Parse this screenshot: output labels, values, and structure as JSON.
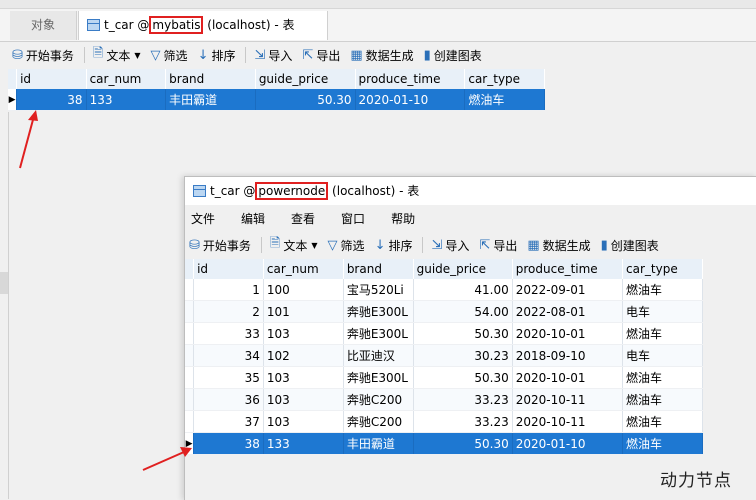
{
  "colors": {
    "selection": "#1e78d2",
    "highlight_box": "#e02020",
    "arrow": "#e02020"
  },
  "top_tabs": {
    "objects_label": "对象",
    "main_prefix": "t_car @",
    "main_db": "mybatis",
    "main_suffix": " (localhost) - 表"
  },
  "toolbar": {
    "begin_tx": "开始事务",
    "text": "文本",
    "filter": "筛选",
    "sort": "排序",
    "import": "导入",
    "export": "导出",
    "gen_data": "数据生成",
    "create_chart": "创建图表"
  },
  "columns": [
    "id",
    "car_num",
    "brand",
    "guide_price",
    "produce_time",
    "car_type"
  ],
  "grid1": {
    "rows": [
      {
        "id": "38",
        "car_num": "133",
        "brand": "丰田霸道",
        "guide_price": "50.30",
        "produce_time": "2020-01-10",
        "car_type": "燃油车"
      }
    ]
  },
  "win2": {
    "title_prefix": "t_car @",
    "title_db": "powernode",
    "title_suffix": " (localhost) - 表",
    "menu": [
      "文件",
      "编辑",
      "查看",
      "窗口",
      "帮助"
    ],
    "rows": [
      {
        "id": "1",
        "car_num": "100",
        "brand": "宝马520Li",
        "guide_price": "41.00",
        "produce_time": "2022-09-01",
        "car_type": "燃油车"
      },
      {
        "id": "2",
        "car_num": "101",
        "brand": "奔驰E300L",
        "guide_price": "54.00",
        "produce_time": "2022-08-01",
        "car_type": "电车"
      },
      {
        "id": "33",
        "car_num": "103",
        "brand": "奔驰E300L",
        "guide_price": "50.30",
        "produce_time": "2020-10-01",
        "car_type": "燃油车"
      },
      {
        "id": "34",
        "car_num": "102",
        "brand": "比亚迪汉",
        "guide_price": "30.23",
        "produce_time": "2018-09-10",
        "car_type": "电车"
      },
      {
        "id": "35",
        "car_num": "103",
        "brand": "奔驰E300L",
        "guide_price": "50.30",
        "produce_time": "2020-10-01",
        "car_type": "燃油车"
      },
      {
        "id": "36",
        "car_num": "103",
        "brand": "奔驰C200",
        "guide_price": "33.23",
        "produce_time": "2020-10-11",
        "car_type": "燃油车"
      },
      {
        "id": "37",
        "car_num": "103",
        "brand": "奔驰C200",
        "guide_price": "33.23",
        "produce_time": "2020-10-11",
        "car_type": "燃油车"
      },
      {
        "id": "38",
        "car_num": "133",
        "brand": "丰田霸道",
        "guide_price": "50.30",
        "produce_time": "2020-01-10",
        "car_type": "燃油车"
      }
    ]
  },
  "watermark": "动力节点"
}
